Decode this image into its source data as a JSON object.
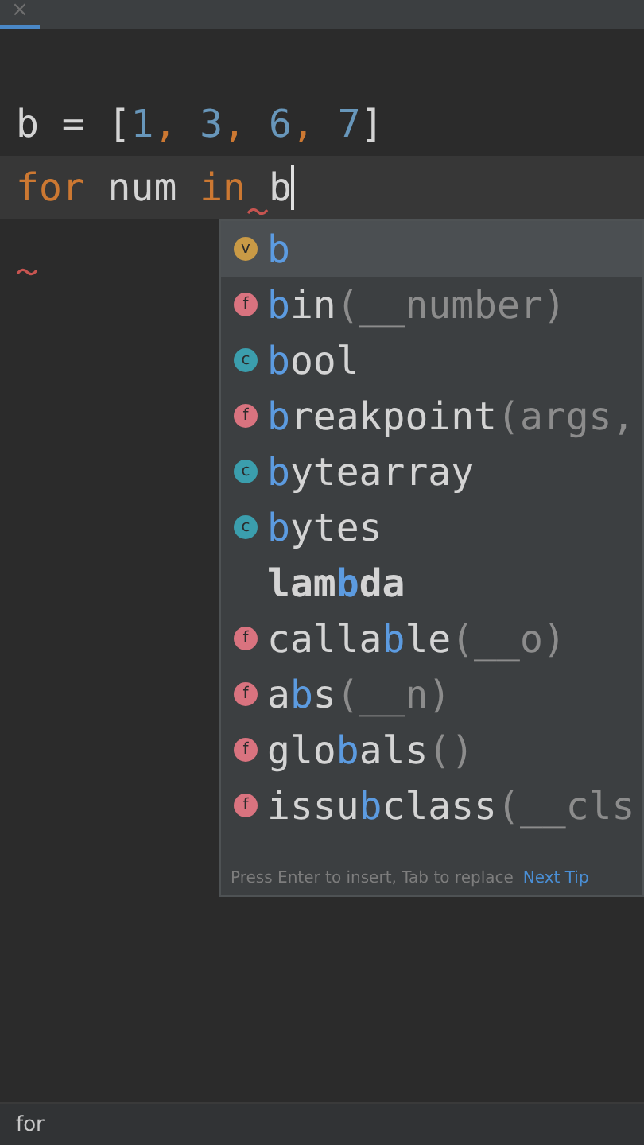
{
  "tabs": [
    {
      "close": "×",
      "selected": true
    }
  ],
  "editor": {
    "lines": [
      {
        "current": false
      },
      {
        "current": false,
        "tokens": [
          {
            "text": "b = [",
            "kind": "plain"
          },
          {
            "text": "1",
            "kind": "number"
          },
          {
            "text": ", ",
            "kind": "comma"
          },
          {
            "text": "3",
            "kind": "number"
          },
          {
            "text": ", ",
            "kind": "comma"
          },
          {
            "text": "6",
            "kind": "number"
          },
          {
            "text": ", ",
            "kind": "comma"
          },
          {
            "text": "7",
            "kind": "number"
          },
          {
            "text": "]",
            "kind": "plain"
          }
        ]
      },
      {
        "current": true,
        "tokens": [
          {
            "text": "for",
            "kind": "keyword"
          },
          {
            "text": " num ",
            "kind": "plain"
          },
          {
            "text": "in",
            "kind": "keyword",
            "error_after": true
          },
          {
            "text": " b",
            "kind": "plain"
          }
        ],
        "caret": true
      },
      {
        "current": false,
        "error": true
      }
    ]
  },
  "completion": {
    "items": [
      {
        "badge": "v",
        "kind": "variable",
        "selected": true,
        "parts": [
          {
            "text": "b",
            "kind": "match"
          }
        ]
      },
      {
        "badge": "f",
        "kind": "function",
        "selected": false,
        "parts": [
          {
            "text": "b",
            "kind": "match"
          },
          {
            "text": "in",
            "kind": "plain"
          },
          {
            "text": "(__number)",
            "kind": "params"
          }
        ]
      },
      {
        "badge": "c",
        "kind": "class",
        "selected": false,
        "parts": [
          {
            "text": "b",
            "kind": "match"
          },
          {
            "text": "ool",
            "kind": "plain"
          }
        ]
      },
      {
        "badge": "f",
        "kind": "function",
        "selected": false,
        "parts": [
          {
            "text": "b",
            "kind": "match"
          },
          {
            "text": "reakpoint",
            "kind": "plain"
          },
          {
            "text": "(args,",
            "kind": "params"
          }
        ]
      },
      {
        "badge": "c",
        "kind": "class",
        "selected": false,
        "parts": [
          {
            "text": "b",
            "kind": "match"
          },
          {
            "text": "ytearray",
            "kind": "plain"
          }
        ]
      },
      {
        "badge": "c",
        "kind": "class",
        "selected": false,
        "parts": [
          {
            "text": "b",
            "kind": "match"
          },
          {
            "text": "ytes",
            "kind": "plain"
          }
        ]
      },
      {
        "kind": "keyword",
        "selected": false,
        "parts": [
          {
            "text": "lam",
            "kind": "plain"
          },
          {
            "text": "b",
            "kind": "match"
          },
          {
            "text": "da",
            "kind": "plain"
          }
        ]
      },
      {
        "badge": "f",
        "kind": "function",
        "selected": false,
        "parts": [
          {
            "text": "calla",
            "kind": "plain"
          },
          {
            "text": "b",
            "kind": "match"
          },
          {
            "text": "le",
            "kind": "plain"
          },
          {
            "text": "(__o)",
            "kind": "params"
          }
        ]
      },
      {
        "badge": "f",
        "kind": "function",
        "selected": false,
        "parts": [
          {
            "text": "a",
            "kind": "plain"
          },
          {
            "text": "b",
            "kind": "match"
          },
          {
            "text": "s",
            "kind": "plain"
          },
          {
            "text": "(__n)",
            "kind": "params"
          }
        ]
      },
      {
        "badge": "f",
        "kind": "function",
        "selected": false,
        "parts": [
          {
            "text": "glo",
            "kind": "plain"
          },
          {
            "text": "b",
            "kind": "match"
          },
          {
            "text": "als",
            "kind": "plain"
          },
          {
            "text": "()",
            "kind": "params"
          }
        ]
      },
      {
        "badge": "f",
        "kind": "function",
        "selected": false,
        "parts": [
          {
            "text": "issu",
            "kind": "plain"
          },
          {
            "text": "b",
            "kind": "match"
          },
          {
            "text": "class",
            "kind": "plain"
          },
          {
            "text": "(__cls",
            "kind": "params"
          }
        ]
      }
    ],
    "hint": "Press Enter to insert, Tab to replace",
    "next_tip": "Next Tip"
  },
  "status_bar": {
    "text": "for"
  }
}
